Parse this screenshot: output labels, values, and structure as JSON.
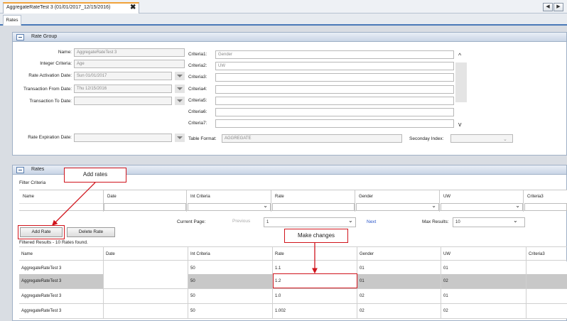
{
  "window": {
    "tab_title": "AggregateRateTest 3 (01/01/2017_12/15/2016)",
    "close_glyph": "✖",
    "nav_prev": "◀",
    "nav_next": "▶",
    "subtab": "Rates"
  },
  "rate_group": {
    "title": "Rate Group",
    "fields": {
      "name": {
        "label": "Name:",
        "value": "AggregateRateTest 3"
      },
      "integer_criteria": {
        "label": "Integer Criteria:",
        "value": "Age"
      },
      "activation_date": {
        "label": "Rate Activation Date:",
        "value": "Sun 01/01/2017"
      },
      "transaction_from": {
        "label": "Transaction From Date:",
        "value": "Thu 12/15/2016"
      },
      "transaction_to": {
        "label": "Transaction To Date:",
        "value": ""
      },
      "expiration_date": {
        "label": "Rate Expiration Date:",
        "value": ""
      },
      "table_format": {
        "label": "Table Format:",
        "value": "AGGREGATE"
      },
      "secondary_index": {
        "label": "Seconday Index:",
        "value": ""
      }
    },
    "criteria": [
      {
        "label": "Criteria1:",
        "value": "Gender"
      },
      {
        "label": "Criteria2:",
        "value": "UW"
      },
      {
        "label": "Criteria3:",
        "value": ""
      },
      {
        "label": "Criteria4:",
        "value": ""
      },
      {
        "label": "Criteria5:",
        "value": ""
      },
      {
        "label": "Criteria6:",
        "value": ""
      },
      {
        "label": "Criteria7:",
        "value": ""
      }
    ],
    "scroll_up": "^",
    "scroll_down": "v"
  },
  "rates": {
    "title": "Rates",
    "filter_criteria_label": "Filter Criteria",
    "filter_headers": [
      "Name",
      "Date",
      "Int Criteria",
      "Rate",
      "Gender",
      "UW",
      "Criteria3"
    ],
    "pager": {
      "current_page_label": "Current Page:",
      "previous": "Previous",
      "page_value": "1",
      "next": "Next",
      "max_results_label": "Max Results:",
      "max_results_value": "10"
    },
    "add_rate": "Add Rate",
    "delete_rate": "Delete Rate",
    "results_text": "Filtered Results - 10 Rates found.",
    "headers": [
      "Name",
      "Date",
      "Int Criteria",
      "Rate",
      "Gender",
      "UW",
      "Criteria3"
    ],
    "rows": [
      {
        "name": "AggregateRateTest 3",
        "date": "",
        "int": "50",
        "rate": "1.1",
        "gender": "01",
        "uw": "01",
        "c3": ""
      },
      {
        "name": "AggregateRateTest 3",
        "date": "",
        "int": "50",
        "rate": "1.2",
        "gender": "01",
        "uw": "02",
        "c3": ""
      },
      {
        "name": "AggregateRateTest 3",
        "date": "",
        "int": "50",
        "rate": "1.0",
        "gender": "02",
        "uw": "01",
        "c3": ""
      },
      {
        "name": "AggregateRateTest 3",
        "date": "",
        "int": "50",
        "rate": "1.002",
        "gender": "02",
        "uw": "02",
        "c3": ""
      }
    ]
  },
  "annotations": {
    "add_rates": "Add rates",
    "make_changes": "Make changes"
  },
  "colors": {
    "annotation_red": "#d0141c",
    "header_blue": "#4a79b8",
    "tab_orange": "#f0a23a"
  }
}
